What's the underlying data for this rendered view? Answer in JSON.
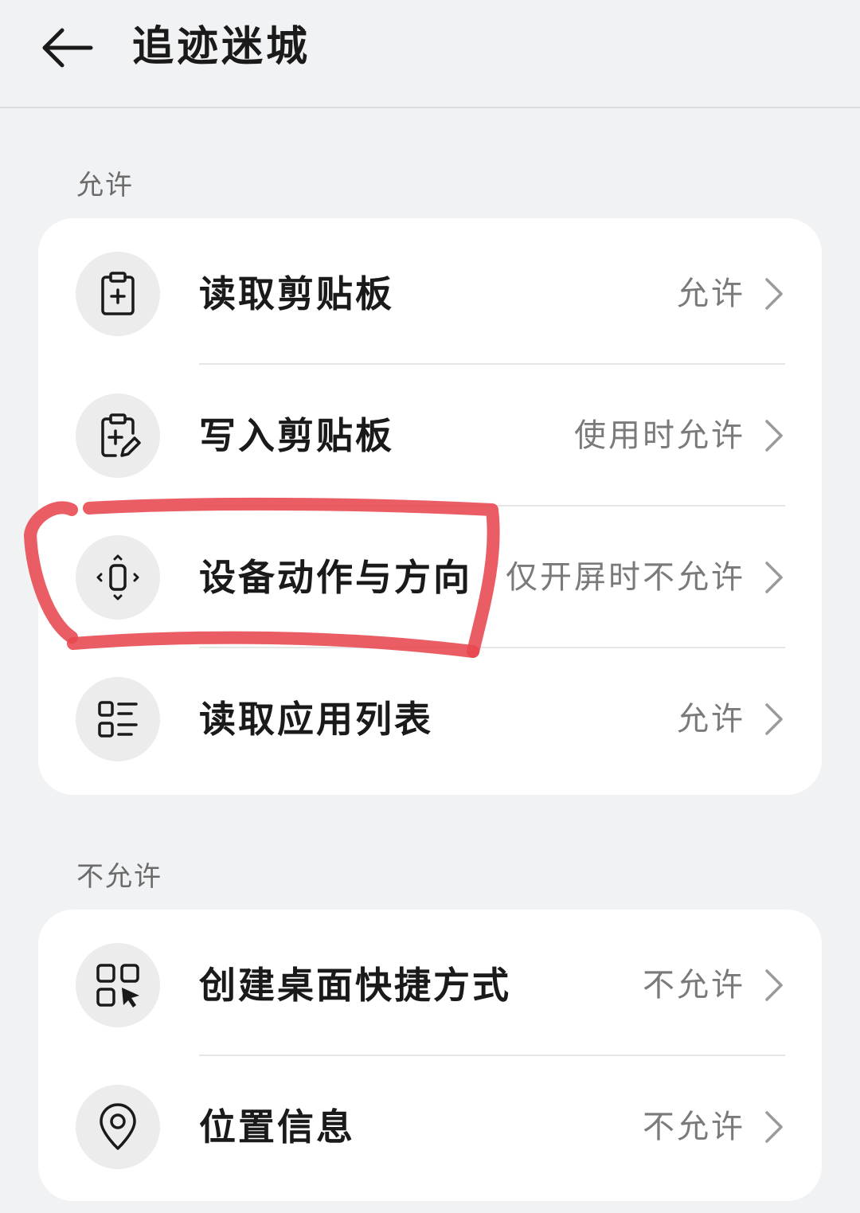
{
  "header": {
    "title": "追迹迷城",
    "back_icon": "arrow-left-icon"
  },
  "sections": [
    {
      "label": "允许",
      "items": [
        {
          "label": "读取剪贴板",
          "value": "允许",
          "icon": "clipboard-add-icon"
        },
        {
          "label": "写入剪贴板",
          "value": "使用时允许",
          "icon": "clipboard-edit-icon"
        },
        {
          "label": "设备动作与方向",
          "value": "仅开屏时不允许",
          "icon": "device-motion-icon"
        },
        {
          "label": "读取应用列表",
          "value": "允许",
          "icon": "app-list-icon"
        }
      ]
    },
    {
      "label": "不允许",
      "items": [
        {
          "label": "创建桌面快捷方式",
          "value": "不允许",
          "icon": "shortcut-grid-icon"
        },
        {
          "label": "位置信息",
          "value": "不允许",
          "icon": "location-pin-icon"
        }
      ]
    }
  ],
  "colors": {
    "background": "#f1f2f4",
    "card": "#ffffff",
    "annotation": "#e8474f",
    "secondary_text": "#7a7a7a"
  }
}
